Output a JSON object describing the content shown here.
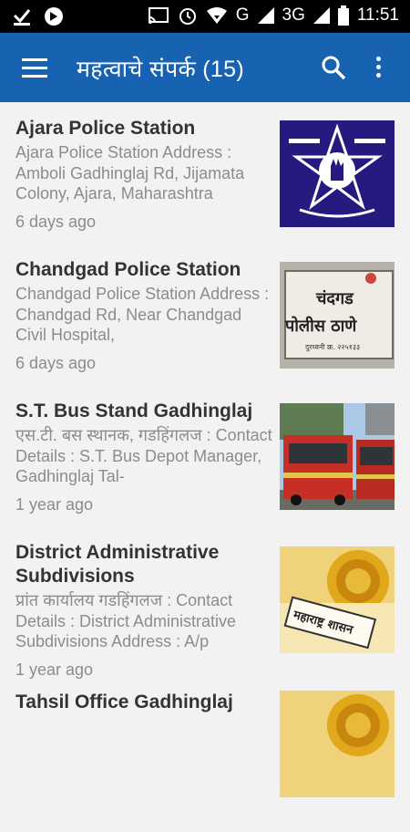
{
  "status_bar": {
    "network": "G",
    "network2": "3G",
    "time": "11:51"
  },
  "app_bar": {
    "title": "महत्वाचे संपर्क (15)",
    "icons": [
      "menu-icon",
      "search-icon",
      "more-vert-icon"
    ]
  },
  "items": [
    {
      "title": "Ajara Police Station",
      "desc": "Ajara Police Station Address : Amboli Gadhinglaj Rd, Jijamata Colony, Ajara, Maharashtra",
      "age": "6 days ago",
      "thumb": "police-emblem"
    },
    {
      "title": "Chandgad Police Station",
      "desc": "Chandgad Police Station Address :  Chandgad Rd, Near Chandgad Civil Hospital,",
      "age": "6 days ago",
      "thumb": "police-signboard",
      "thumb_sign_line1": "चंदगड",
      "thumb_sign_line2": "पोलीस ठाणे",
      "thumb_sign_phone": "दुरध्वनी क्र. २२५१३३"
    },
    {
      "title": "S.T. Bus Stand Gadhinglaj",
      "desc": "एस.टी. बस स्थानक, गडहिंगलज : Contact Details : S.T. Bus Depot Manager, Gadhinglaj  Tal-",
      "age": "1 year ago",
      "thumb": "buses"
    },
    {
      "title": "District Administrative Subdivisions",
      "desc": "प्रांत कार्यालय गडहिंगलज : Contact Details : District Administrative Subdivisions Address :  A/p",
      "age": "1 year ago",
      "thumb": "maharashtra-shasan",
      "thumb_label": "महाराष्ट्र शासन"
    },
    {
      "title": "Tahsil Office Gadhinglaj",
      "desc": "",
      "age": "",
      "thumb": "maharashtra-shasan"
    }
  ]
}
